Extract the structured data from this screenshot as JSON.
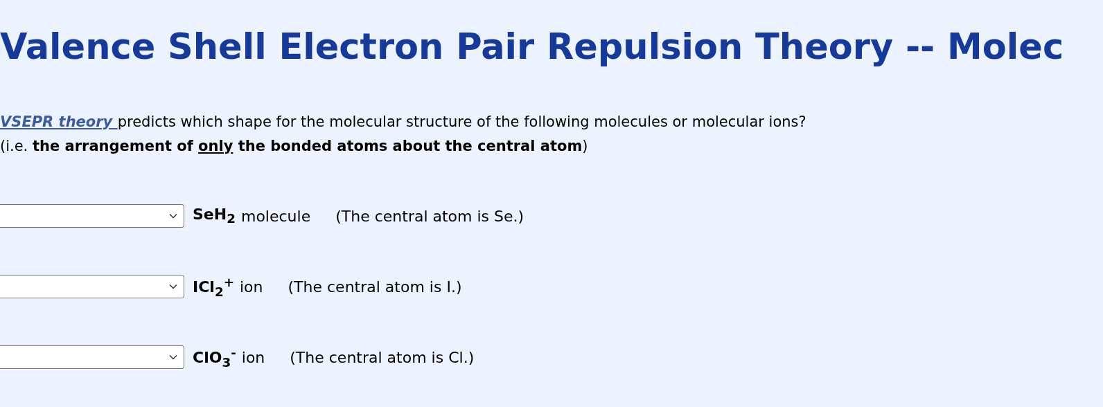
{
  "heading": "Valence Shell Electron Pair Repulsion Theory -- Molec",
  "intro": {
    "link": "VSEPR theory ",
    "text": "predicts which shape for the molecular structure of the following molecules or molecular ions?"
  },
  "note": {
    "prefix": "(i.e. ",
    "bold_before": "the arrangement of ",
    "underlined": "only",
    "bold_after": " the bonded atoms about the central atom",
    "suffix": ")"
  },
  "questions": [
    {
      "formula": "SeH$_{2}$",
      "kind_label": "molecule",
      "hint": "(The central atom is Se.)"
    },
    {
      "formula": "ICl$_{2}$$^{+}$",
      "kind_label": "ion",
      "hint": "(The central atom is I.)"
    },
    {
      "formula": "ClO$_{3}$$^{-}$",
      "kind_label": "ion",
      "hint": "(The central atom is Cl.)"
    }
  ]
}
